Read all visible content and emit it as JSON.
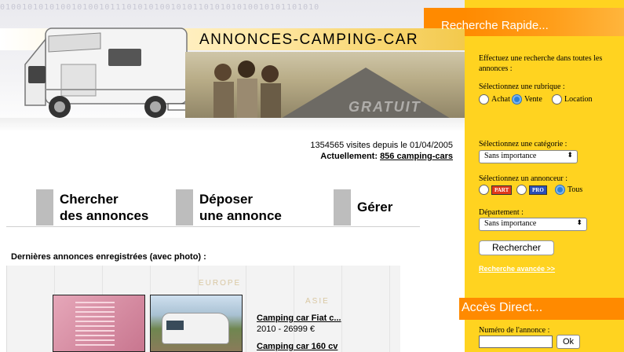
{
  "header": {
    "site_title": "ANNONCES-CAMPING-CAR",
    "binary_decor": "0100101010100101001011101010100101011010101010010101101010",
    "photo_overlay": "GRATUIT"
  },
  "stats": {
    "visits": "1354565 visites depuis le 01/04/2005",
    "current_label": "Actuellement:",
    "current_link": "856 camping-cars"
  },
  "nav": {
    "search": [
      "Chercher",
      "des annonces"
    ],
    "post": [
      "Déposer",
      "une annonce"
    ],
    "manage": "Gérer"
  },
  "latest": {
    "title": "Dernières annonces enregistrées (avec photo) :",
    "zones": [
      "EUROPE",
      "ASIE"
    ],
    "ads": [
      {
        "title": "Camping car Fiat c...",
        "detail": "2010 - 26999 €"
      },
      {
        "title": "Camping car 160 cv",
        "detail": ""
      }
    ]
  },
  "quick_search": {
    "title": "Recherche Rapide...",
    "intro": "Effectuez une recherche dans toutes les annonces :",
    "rubrique_label": "Sélectionnez une rubrique :",
    "rubriques": [
      "Achat",
      "Vente",
      "Location"
    ],
    "rubrique_selected": "Vente",
    "category_label": "Sélectionnez une catégorie :",
    "category_value": "Sans importance",
    "advertiser_label": "Sélectionnez un annonceur :",
    "advertisers": [
      "PART",
      "PRO",
      "Tous"
    ],
    "advertiser_selected": "Tous",
    "department_label": "Département :",
    "department_value": "Sans importance",
    "search_button": "Rechercher",
    "advanced_link": "Recherche avancée >>"
  },
  "direct_access": {
    "title": "Accès Direct...",
    "number_label": "Numéro de l'annonce :",
    "ok_button": "Ok"
  },
  "colors": {
    "panel_yellow": "#ffd320",
    "panel_orange": "#ff8a00",
    "nav_bar_grey": "#bdbdbd"
  }
}
